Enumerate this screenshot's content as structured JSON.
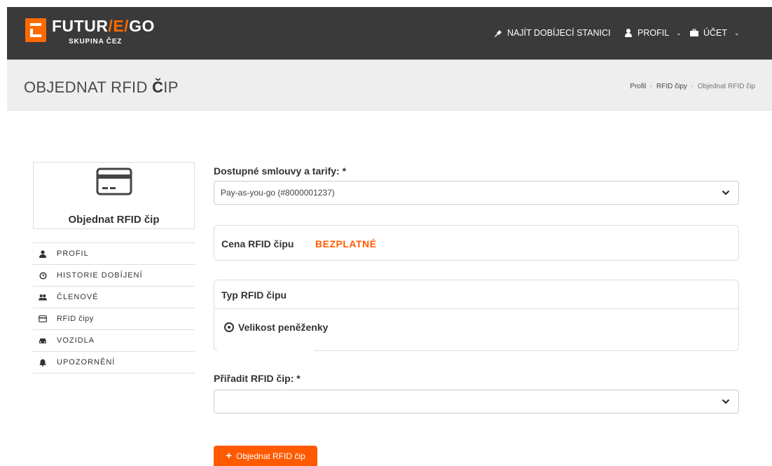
{
  "header": {
    "logo_text_a": "FUTUR",
    "logo_slash_a": "/",
    "logo_text_e": "E",
    "logo_slash_b": "/",
    "logo_text_b": "GO",
    "logo_sub": "SKUPINA ČEZ",
    "nav": {
      "find_station": "NAJÍT DOBÍJECÍ STANICI",
      "profile": "PROFIL",
      "account": "ÚČET"
    }
  },
  "subheader": {
    "title_light": "OBJEDNAT RFID ",
    "title_bold": "Č",
    "title_tail": "IP",
    "breadcrumb": [
      "Profil",
      "RFID čipy",
      "Objednat RFID čip"
    ]
  },
  "sidebar": {
    "card_title": "Objednat RFID čip",
    "items": [
      {
        "label": "PROFIL",
        "icon": "user-icon"
      },
      {
        "label": "HISTORIE DOBÍJENÍ",
        "icon": "clock-icon"
      },
      {
        "label": "ČLENOVÉ",
        "icon": "users-icon"
      },
      {
        "label": "RFID čipy",
        "icon": "card-icon"
      },
      {
        "label": "VOZIDLA",
        "icon": "car-icon"
      },
      {
        "label": "UPOZORNĚNÍ",
        "icon": "bell-icon"
      }
    ]
  },
  "form": {
    "contracts_label": "Dostupné smlouvy a tarify: *",
    "contracts_value": "Pay-as-you-go (#8000001237)",
    "price_label": "Cena RFID čipu",
    "price_value": "BEZPLATNÉ",
    "type_label": "Typ RFID čipu",
    "type_option": "Velikost peněženky",
    "assign_label": "Přiřadit RFID čip: *",
    "assign_value": "",
    "submit_label": "Objednat RFID čip"
  },
  "colors": {
    "accent": "#ff5a00",
    "topbar": "#3a3a3a",
    "subheader": "#eeeeee"
  }
}
